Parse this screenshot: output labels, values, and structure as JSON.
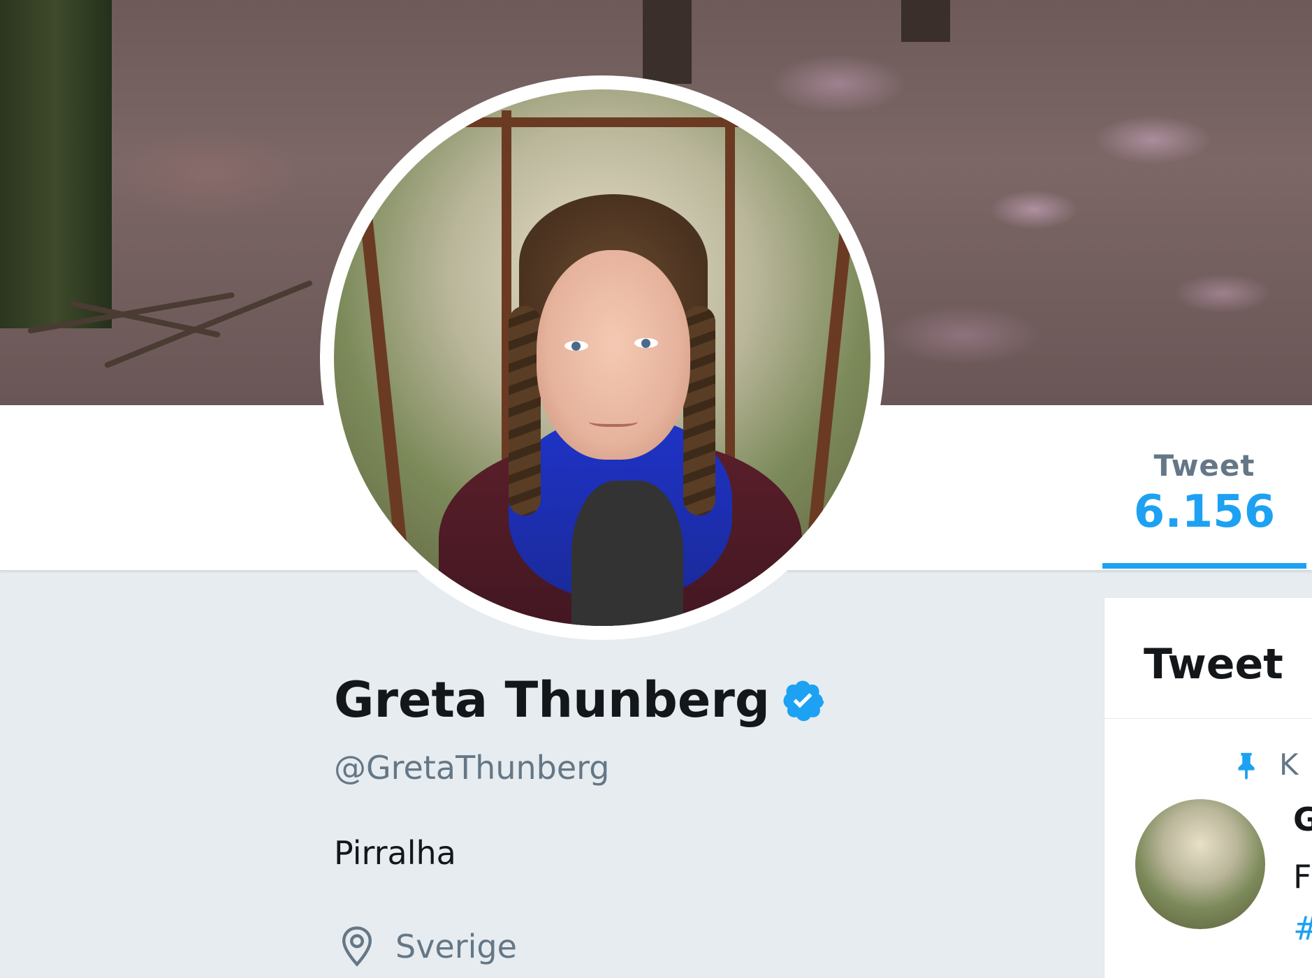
{
  "profile": {
    "name": "Greta Thunberg",
    "handle": "@GretaThunberg",
    "bio": "Pirralha",
    "location": "Sverige",
    "verified": true
  },
  "nav": {
    "tweets_label": "Tweet",
    "tweets_count": "6.156",
    "active_color": "#1da1f2"
  },
  "timeline": {
    "title": "Tweet",
    "pinned_label": "K",
    "pinned_tweet": {
      "author_initial": "G",
      "text_start": "F",
      "tag_start": "#"
    }
  },
  "icons": {
    "verified": "verified-badge-icon",
    "location": "location-pin-icon",
    "pin": "pushpin-icon"
  }
}
